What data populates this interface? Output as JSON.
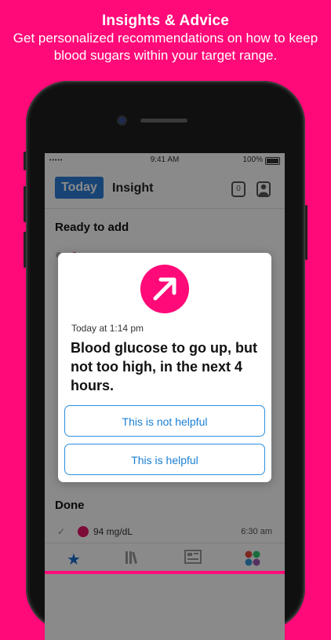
{
  "promo": {
    "title": "Insights & Advice",
    "subtitle": "Get personalized recommendations on how to keep blood sugars within your target range."
  },
  "status_bar": {
    "time": "9:41 AM",
    "battery": "100%"
  },
  "nav": {
    "today_label": "Today",
    "title": "Insight",
    "badge_count": "0"
  },
  "sections": {
    "ready_label": "Ready to add",
    "done_label": "Done"
  },
  "done_entry": {
    "value": "94 mg/dL",
    "time": "6:30 am"
  },
  "dialog": {
    "timestamp": "Today at 1:14 pm",
    "message": "Blood glucose to go up, but not too high, in the next 4 hours.",
    "not_helpful_label": "This is not helpful",
    "helpful_label": "This is helpful"
  },
  "colors": {
    "brand": "#ff0a78",
    "accent": "#2b7fd8"
  },
  "tabs": [
    {
      "icon": "star-icon"
    },
    {
      "icon": "library-icon"
    },
    {
      "icon": "news-icon"
    },
    {
      "icon": "apps-icon"
    }
  ]
}
